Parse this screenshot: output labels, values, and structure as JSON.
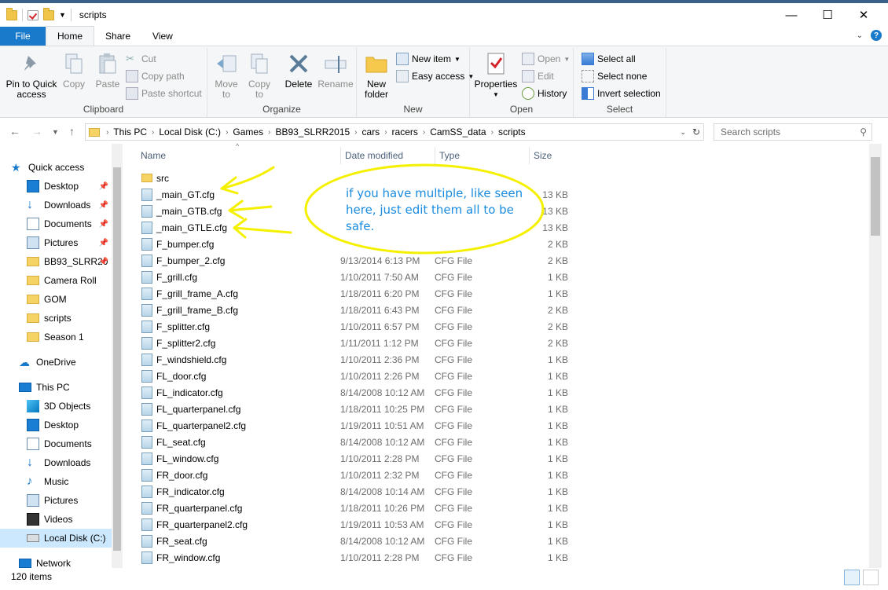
{
  "window": {
    "title": "scripts",
    "controls": {
      "minimize": "—",
      "maximize": "☐",
      "close": "✕"
    }
  },
  "tabs": [
    {
      "label": "File"
    },
    {
      "label": "Home"
    },
    {
      "label": "Share"
    },
    {
      "label": "View"
    }
  ],
  "ribbon": {
    "clipboard": {
      "pin_label": "Pin to Quick access",
      "copy_label": "Copy",
      "paste_label": "Paste",
      "cut_label": "Cut",
      "copy_path_label": "Copy path",
      "paste_shortcut_label": "Paste shortcut",
      "group_label": "Clipboard"
    },
    "organize": {
      "move_label": "Move to",
      "copy_label": "Copy to",
      "delete_label": "Delete",
      "rename_label": "Rename",
      "group_label": "Organize"
    },
    "new": {
      "new_folder_label": "New folder",
      "new_item_label": "New item",
      "easy_access_label": "Easy access",
      "group_label": "New"
    },
    "open": {
      "properties_label": "Properties",
      "open_label": "Open",
      "edit_label": "Edit",
      "history_label": "History",
      "group_label": "Open"
    },
    "select": {
      "select_all_label": "Select all",
      "select_none_label": "Select none",
      "invert_label": "Invert selection",
      "group_label": "Select"
    }
  },
  "address": {
    "crumbs": [
      "This PC",
      "Local Disk (C:)",
      "Games",
      "BB93_SLRR2015",
      "cars",
      "racers",
      "CamSS_data",
      "scripts"
    ],
    "search_placeholder": "Search scripts"
  },
  "nav": {
    "quick_access": "Quick access",
    "quick_items": [
      "Desktop",
      "Downloads",
      "Documents",
      "Pictures",
      "BB93_SLRR20",
      "Camera Roll",
      "GOM",
      "scripts",
      "Season 1"
    ],
    "onedrive": "OneDrive",
    "this_pc": "This PC",
    "pc_items": [
      "3D Objects",
      "Desktop",
      "Documents",
      "Downloads",
      "Music",
      "Pictures",
      "Videos",
      "Local Disk (C:)"
    ],
    "network": "Network"
  },
  "columns": {
    "name": "Name",
    "date": "Date modified",
    "type": "Type",
    "size": "Size"
  },
  "files": [
    {
      "name": "src",
      "date": "",
      "type": "",
      "size": "",
      "folder": true
    },
    {
      "name": "_main_GT.cfg",
      "date": "",
      "type": "",
      "size": "13 KB"
    },
    {
      "name": "_main_GTB.cfg",
      "date": "",
      "type": "",
      "size": "13 KB"
    },
    {
      "name": "_main_GTLE.cfg",
      "date": "",
      "type": "",
      "size": "13 KB"
    },
    {
      "name": "F_bumper.cfg",
      "date": "",
      "type": "",
      "size": "2 KB"
    },
    {
      "name": "F_bumper_2.cfg",
      "date": "9/13/2014 6:13 PM",
      "type": "CFG File",
      "size": "2 KB"
    },
    {
      "name": "F_grill.cfg",
      "date": "1/10/2011 7:50 AM",
      "type": "CFG File",
      "size": "1 KB"
    },
    {
      "name": "F_grill_frame_A.cfg",
      "date": "1/18/2011 6:20 PM",
      "type": "CFG File",
      "size": "1 KB"
    },
    {
      "name": "F_grill_frame_B.cfg",
      "date": "1/18/2011 6:43 PM",
      "type": "CFG File",
      "size": "2 KB"
    },
    {
      "name": "F_splitter.cfg",
      "date": "1/10/2011 6:57 PM",
      "type": "CFG File",
      "size": "2 KB"
    },
    {
      "name": "F_splitter2.cfg",
      "date": "1/11/2011 1:12 PM",
      "type": "CFG File",
      "size": "2 KB"
    },
    {
      "name": "F_windshield.cfg",
      "date": "1/10/2011 2:36 PM",
      "type": "CFG File",
      "size": "1 KB"
    },
    {
      "name": "FL_door.cfg",
      "date": "1/10/2011 2:26 PM",
      "type": "CFG File",
      "size": "1 KB"
    },
    {
      "name": "FL_indicator.cfg",
      "date": "8/14/2008 10:12 AM",
      "type": "CFG File",
      "size": "1 KB"
    },
    {
      "name": "FL_quarterpanel.cfg",
      "date": "1/18/2011 10:25 PM",
      "type": "CFG File",
      "size": "1 KB"
    },
    {
      "name": "FL_quarterpanel2.cfg",
      "date": "1/19/2011 10:51 AM",
      "type": "CFG File",
      "size": "1 KB"
    },
    {
      "name": "FL_seat.cfg",
      "date": "8/14/2008 10:12 AM",
      "type": "CFG File",
      "size": "1 KB"
    },
    {
      "name": "FL_window.cfg",
      "date": "1/10/2011 2:28 PM",
      "type": "CFG File",
      "size": "1 KB"
    },
    {
      "name": "FR_door.cfg",
      "date": "1/10/2011 2:32 PM",
      "type": "CFG File",
      "size": "1 KB"
    },
    {
      "name": "FR_indicator.cfg",
      "date": "8/14/2008 10:14 AM",
      "type": "CFG File",
      "size": "1 KB"
    },
    {
      "name": "FR_quarterpanel.cfg",
      "date": "1/18/2011 10:26 PM",
      "type": "CFG File",
      "size": "1 KB"
    },
    {
      "name": "FR_quarterpanel2.cfg",
      "date": "1/19/2011 10:53 AM",
      "type": "CFG File",
      "size": "1 KB"
    },
    {
      "name": "FR_seat.cfg",
      "date": "8/14/2008 10:12 AM",
      "type": "CFG File",
      "size": "1 KB"
    },
    {
      "name": "FR_window.cfg",
      "date": "1/10/2011 2:28 PM",
      "type": "CFG File",
      "size": "1 KB"
    }
  ],
  "status": {
    "items": "120 items"
  },
  "annotation": {
    "note": "if you have multiple, like seen here, just edit them all to be safe.",
    "color": "#f5f000"
  }
}
